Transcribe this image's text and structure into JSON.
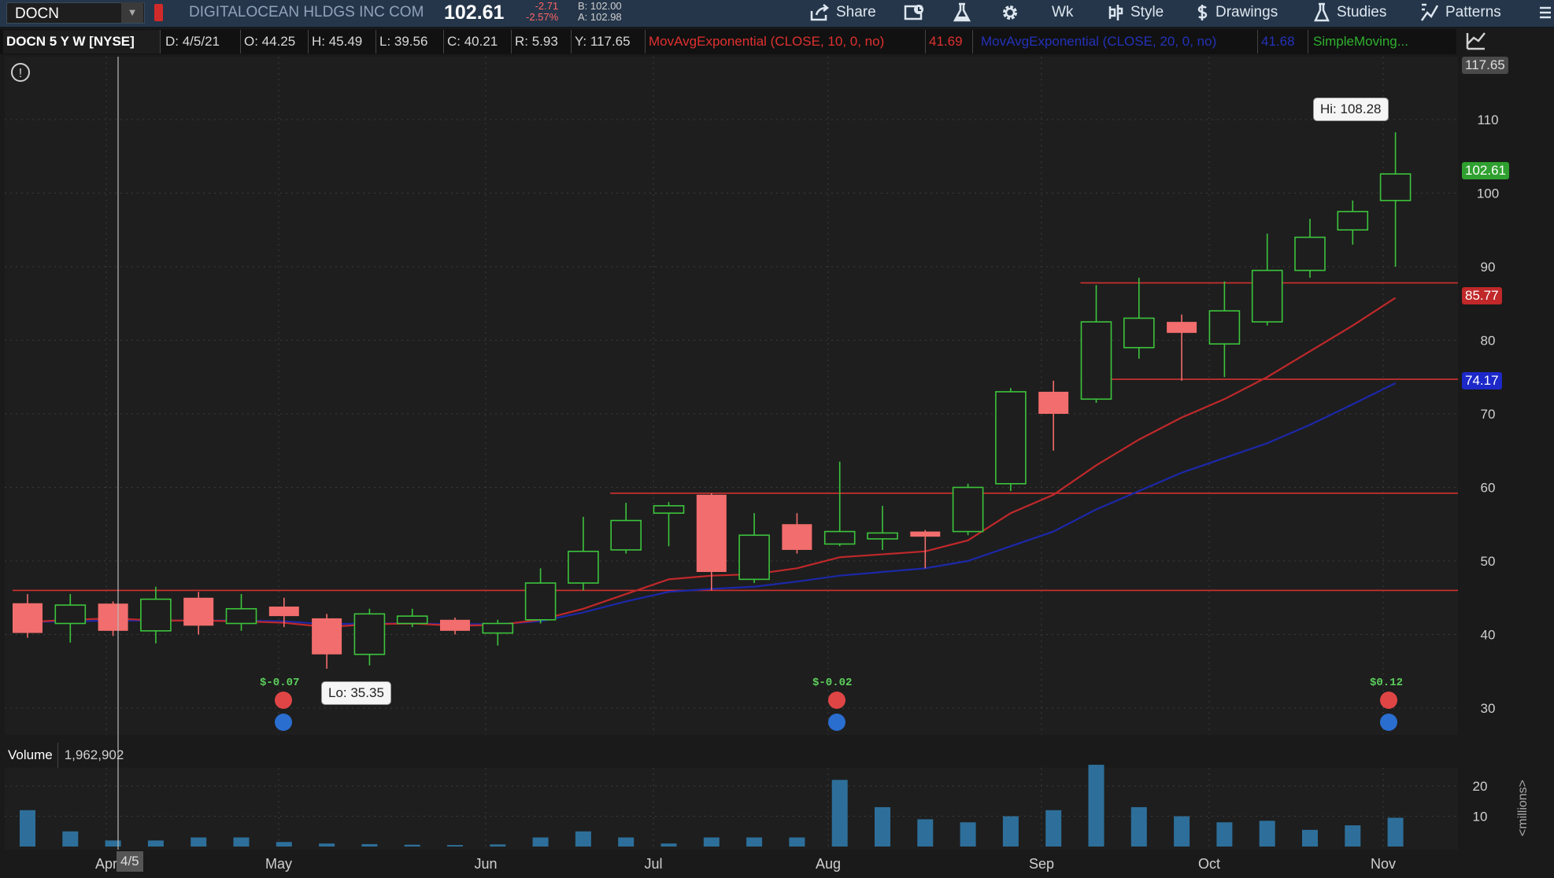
{
  "symbol": "DOCN",
  "company": "DIGITALOCEAN HLDGS INC COM",
  "last_price": "102.61",
  "change": "-2.71",
  "change_pct": "-2.57%",
  "bid": "B: 102.00",
  "ask": "A: 102.98",
  "toolbar": {
    "share": "Share",
    "timeframe": "Wk",
    "style": "Style",
    "drawings": "Drawings",
    "studies": "Studies",
    "patterns": "Patterns"
  },
  "info": {
    "title": "DOCN 5 Y W [NYSE]",
    "date": "D: 4/5/21",
    "open": "O: 44.25",
    "high": "H: 45.49",
    "low": "L: 39.56",
    "close": "C: 40.21",
    "range": "R: 5.93",
    "y": "Y: 117.65",
    "ema10": "MovAvgExponential (CLOSE, 10, 0, no)",
    "ema10_val": "41.69",
    "ema20": "MovAvgExponential (CLOSE, 20, 0, no)",
    "ema20_val": "41.68",
    "sma": "SimpleMoving..."
  },
  "tags": {
    "crosshair": "117.65",
    "last": "102.61",
    "ema10": "85.77",
    "ema20": "74.17"
  },
  "callouts": {
    "hi": "Hi: 108.28",
    "lo": "Lo: 35.35"
  },
  "earnings": [
    "$-0.07",
    "$-0.02",
    "$0.12"
  ],
  "volume_label": "Volume",
  "volume_value": "1,962,902",
  "volume_unit": "<millions>",
  "crosshair_date": "4/5",
  "colors": {
    "up": "#3cc43c",
    "down": "#f26d6d",
    "ema10": "#c0282a",
    "ema20": "#1c28a8",
    "level": "#d23030",
    "volume": "#2d6f9a",
    "sma": "#3cbc3c"
  },
  "chart_data": {
    "type": "candlestick",
    "title": "DOCN 5 Y W [NYSE]",
    "price_axis": {
      "ticks": [
        30,
        40,
        50,
        60,
        70,
        80,
        90,
        100,
        110
      ],
      "ylim": [
        25,
        117.65
      ]
    },
    "volume_axis": {
      "ticks": [
        10,
        20
      ],
      "ylim": [
        0,
        27
      ],
      "unit": "<millions>"
    },
    "x_ticks": [
      "Apr",
      "May",
      "Jun",
      "Jul",
      "Aug",
      "Sep",
      "Oct",
      "Nov"
    ],
    "candles": [
      {
        "open": 44.25,
        "high": 45.49,
        "low": 39.56,
        "close": 40.21
      },
      {
        "open": 41.5,
        "high": 45.5,
        "low": 38.9,
        "close": 44.0
      },
      {
        "open": 44.2,
        "high": 44.5,
        "low": 39.8,
        "close": 40.5
      },
      {
        "open": 40.5,
        "high": 46.5,
        "low": 38.8,
        "close": 44.8
      },
      {
        "open": 45.0,
        "high": 45.8,
        "low": 40.0,
        "close": 41.2
      },
      {
        "open": 41.5,
        "high": 45.5,
        "low": 40.5,
        "close": 43.5
      },
      {
        "open": 43.8,
        "high": 45.0,
        "low": 41.0,
        "close": 42.5
      },
      {
        "open": 42.2,
        "high": 42.8,
        "low": 35.35,
        "close": 37.3
      },
      {
        "open": 37.3,
        "high": 43.5,
        "low": 35.8,
        "close": 42.8
      },
      {
        "open": 41.5,
        "high": 43.5,
        "low": 41.0,
        "close": 42.5
      },
      {
        "open": 42.0,
        "high": 42.3,
        "low": 40.0,
        "close": 40.5
      },
      {
        "open": 40.2,
        "high": 42.0,
        "low": 38.5,
        "close": 41.5
      },
      {
        "open": 42.0,
        "high": 49.0,
        "low": 41.5,
        "close": 47.0
      },
      {
        "open": 47.0,
        "high": 56.0,
        "low": 46.0,
        "close": 51.3
      },
      {
        "open": 51.5,
        "high": 57.9,
        "low": 51.0,
        "close": 55.5
      },
      {
        "open": 56.5,
        "high": 58.0,
        "low": 52.0,
        "close": 57.5
      },
      {
        "open": 59.0,
        "high": 59.2,
        "low": 46.0,
        "close": 48.5
      },
      {
        "open": 47.5,
        "high": 56.5,
        "low": 47.0,
        "close": 53.5
      },
      {
        "open": 55.0,
        "high": 56.5,
        "low": 51.0,
        "close": 51.5
      },
      {
        "open": 52.3,
        "high": 63.5,
        "low": 52.0,
        "close": 54.0
      },
      {
        "open": 53.0,
        "high": 57.5,
        "low": 51.5,
        "close": 53.8
      },
      {
        "open": 54.0,
        "high": 54.2,
        "low": 49.0,
        "close": 53.3
      },
      {
        "open": 54.0,
        "high": 60.5,
        "low": 53.5,
        "close": 60.0
      },
      {
        "open": 60.5,
        "high": 73.5,
        "low": 59.5,
        "close": 73.0
      },
      {
        "open": 73.0,
        "high": 74.5,
        "low": 65.0,
        "close": 70.0
      },
      {
        "open": 72.0,
        "high": 87.5,
        "low": 71.5,
        "close": 82.5
      },
      {
        "open": 79.0,
        "high": 88.5,
        "low": 77.5,
        "close": 83.0
      },
      {
        "open": 82.5,
        "high": 83.5,
        "low": 74.5,
        "close": 81.0
      },
      {
        "open": 79.5,
        "high": 88.0,
        "low": 75.0,
        "close": 84.0
      },
      {
        "open": 82.5,
        "high": 94.5,
        "low": 82.0,
        "close": 89.5
      },
      {
        "open": 89.5,
        "high": 96.5,
        "low": 88.5,
        "close": 94.0
      },
      {
        "open": 95.0,
        "high": 99.0,
        "low": 93.0,
        "close": 97.5
      },
      {
        "open": 99.0,
        "high": 108.28,
        "low": 90.0,
        "close": 102.61
      }
    ],
    "volume_millions": [
      12,
      5,
      2,
      2,
      3,
      3,
      1.5,
      1,
      0.8,
      0.6,
      0.5,
      0.7,
      3,
      5,
      3,
      1,
      3,
      3,
      3,
      22,
      13,
      9,
      8,
      10,
      12,
      27,
      13,
      10,
      8,
      8.5,
      5.5,
      7,
      9.5
    ],
    "ema10": [
      41.7,
      42.0,
      42.2,
      41.9,
      41.9,
      41.8,
      41.6,
      41.0,
      41.4,
      41.5,
      41.2,
      41.3,
      42.0,
      43.5,
      45.5,
      47.5,
      48.0,
      48.2,
      49.0,
      50.5,
      50.9,
      51.3,
      52.8,
      56.5,
      59.0,
      63.0,
      66.5,
      69.5,
      72.0,
      75.0,
      78.5,
      82.0,
      85.77
    ],
    "ema20": [
      41.7,
      41.8,
      41.9,
      41.9,
      41.9,
      41.9,
      41.8,
      41.4,
      41.5,
      41.5,
      41.4,
      41.4,
      41.8,
      43.0,
      44.5,
      45.8,
      46.2,
      46.5,
      47.2,
      48.0,
      48.5,
      49.0,
      50.0,
      52.0,
      54.0,
      57.0,
      59.5,
      62.0,
      64.0,
      66.0,
      68.5,
      71.3,
      74.17
    ],
    "horizontal_lines": [
      {
        "value": 46.0,
        "from_bar": 0
      },
      {
        "value": 59.2,
        "from_bar": 14
      },
      {
        "value": 87.8,
        "from_bar": 25
      },
      {
        "value": 74.7,
        "from_bar": 25
      }
    ]
  }
}
